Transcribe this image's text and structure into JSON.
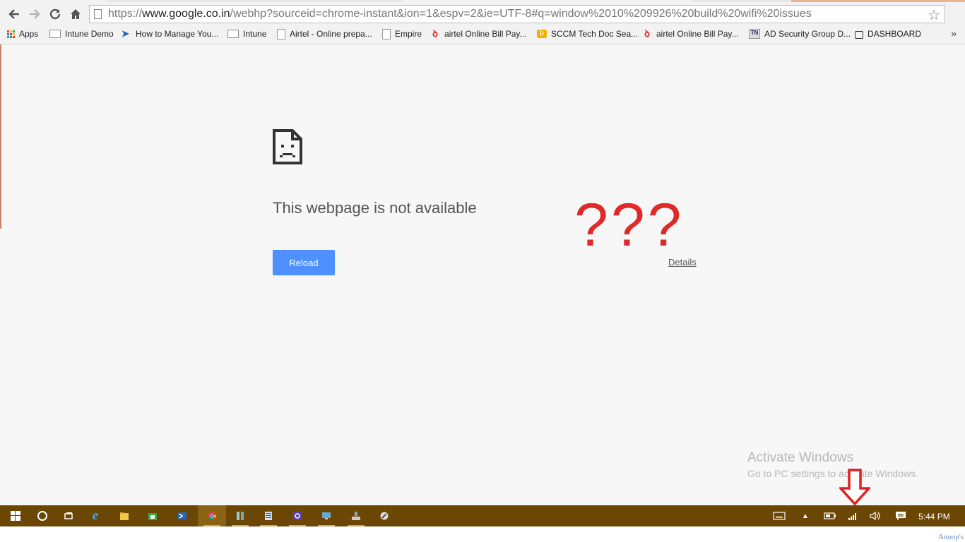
{
  "browser": {
    "url_prefix": "https://",
    "url_host": "www.google.co.in",
    "url_path": "/webhp?sourceid=chrome-instant&ion=1&espv=2&ie=UTF-8#q=window%2010%209926%20build%20wifi%20issues",
    "bookmarks": [
      {
        "label": "Apps",
        "icon": "apps-grid-icon"
      },
      {
        "label": "Intune Demo",
        "icon": "folder-icon"
      },
      {
        "label": "How to Manage You...",
        "icon": "link-arrow-icon"
      },
      {
        "label": "Intune",
        "icon": "folder-icon"
      },
      {
        "label": "Airtel - Online prepa...",
        "icon": "page-icon"
      },
      {
        "label": "Empire",
        "icon": "page-icon"
      },
      {
        "label": "airtel Online Bill Pay...",
        "icon": "airtel-icon"
      },
      {
        "label": "SCCM Tech Doc Sea...",
        "icon": "bing-icon"
      },
      {
        "label": "airtel Online Bill Pay...",
        "icon": "airtel-icon"
      },
      {
        "label": "AD Security Group D...",
        "icon": "tn-icon"
      },
      {
        "label": "DASHBOARD",
        "icon": "lock-icon"
      }
    ],
    "bookmarks_more": "»"
  },
  "error_page": {
    "title": "This webpage is not available",
    "reload_label": "Reload",
    "details_label": "Details"
  },
  "annotation": {
    "text": "???",
    "color": "#e02a2a"
  },
  "watermark": {
    "line1": "Activate Windows",
    "line2": "Go to PC settings to activate Windows."
  },
  "taskbar": {
    "color": "#6b4604",
    "clock": "5:44 PM"
  },
  "credit": "Anoop's"
}
